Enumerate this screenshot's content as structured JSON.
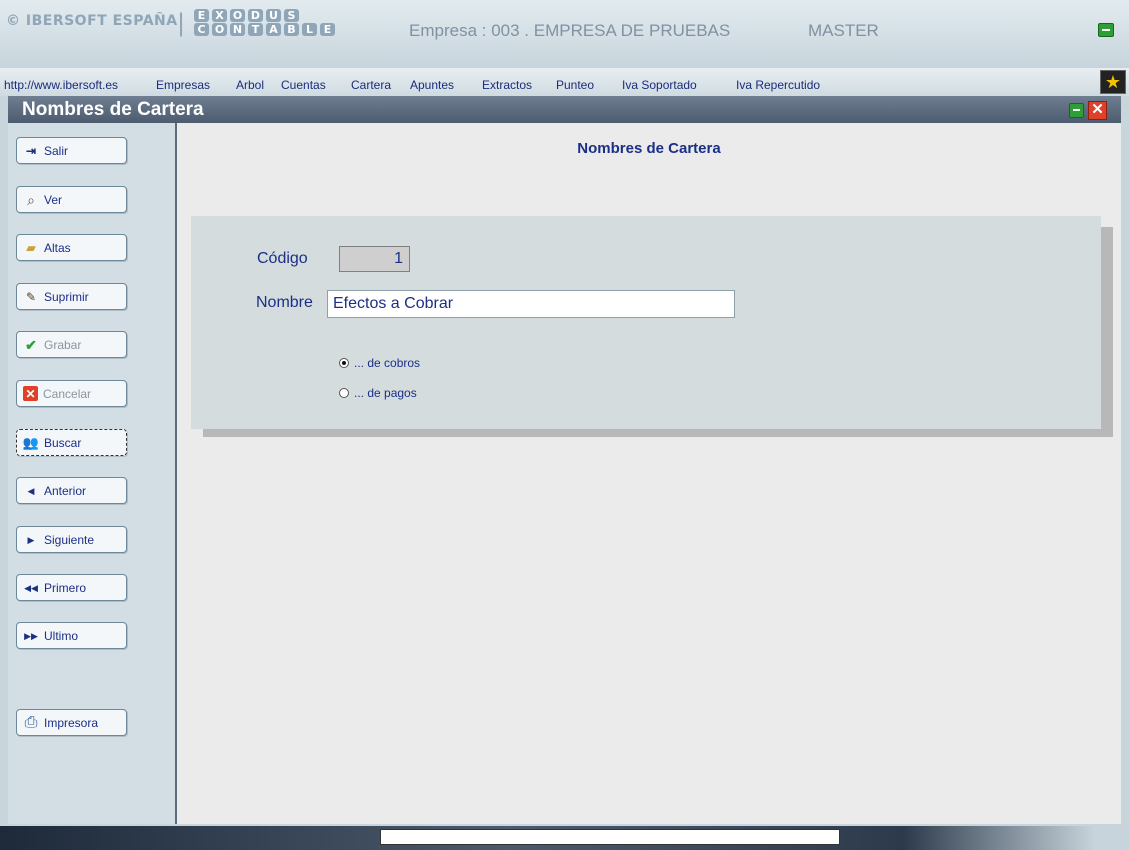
{
  "banner": {
    "brand": "© IBERSOFT ESPAÑA",
    "separator": "|",
    "product_line1": [
      "E",
      "X",
      "O",
      "D",
      "U",
      "S"
    ],
    "product_line2": [
      "C",
      "O",
      "N",
      "T",
      "A",
      "B",
      "L",
      "E"
    ],
    "company": "Empresa : 003 . EMPRESA DE PRUEBAS",
    "user": "MASTER"
  },
  "menu": {
    "url": "http://www.ibersoft.es",
    "items": [
      "Empresas",
      "Arbol",
      "Cuentas",
      "Cartera",
      "Apuntes",
      "Extractos",
      "Punteo",
      "Iva Soportado",
      "Iva Repercutido"
    ]
  },
  "window": {
    "title": "Nombres de Cartera"
  },
  "toolbar": {
    "buttons": [
      {
        "label": "Salir",
        "icon": "exit-door-icon",
        "enabled": true
      },
      {
        "label": "Ver",
        "icon": "magnifier-icon",
        "enabled": true
      },
      {
        "label": "Altas",
        "icon": "open-folder-icon",
        "enabled": true
      },
      {
        "label": "Suprimir",
        "icon": "eraser-icon",
        "enabled": true
      },
      {
        "label": "Grabar",
        "icon": "checkmark-icon",
        "enabled": false
      },
      {
        "label": "Cancelar",
        "icon": "red-x-icon",
        "enabled": false
      },
      {
        "label": "Buscar",
        "icon": "users-search-icon",
        "enabled": true
      },
      {
        "label": "Anterior",
        "icon": "arrow-left-icon",
        "enabled": true
      },
      {
        "label": "Siguiente",
        "icon": "arrow-right-icon",
        "enabled": true
      },
      {
        "label": "Primero",
        "icon": "double-arrow-left-icon",
        "enabled": true
      },
      {
        "label": "Ultimo",
        "icon": "double-arrow-right-icon",
        "enabled": true
      },
      {
        "label": "Impresora",
        "icon": "printer-icon",
        "enabled": true
      }
    ]
  },
  "form": {
    "title": "Nombres de Cartera",
    "code_label": "Código",
    "code_value": "1",
    "name_label": "Nombre",
    "name_value": "Efectos a Cobrar",
    "radio_options": [
      {
        "label": "... de cobros",
        "selected": true
      },
      {
        "label": "... de pagos",
        "selected": false
      }
    ]
  },
  "colors": {
    "accent_text": "#1b2f86",
    "titlebar": "#4c5b6d",
    "close_red": "#e04028",
    "minimize_green": "#2e9e37"
  }
}
